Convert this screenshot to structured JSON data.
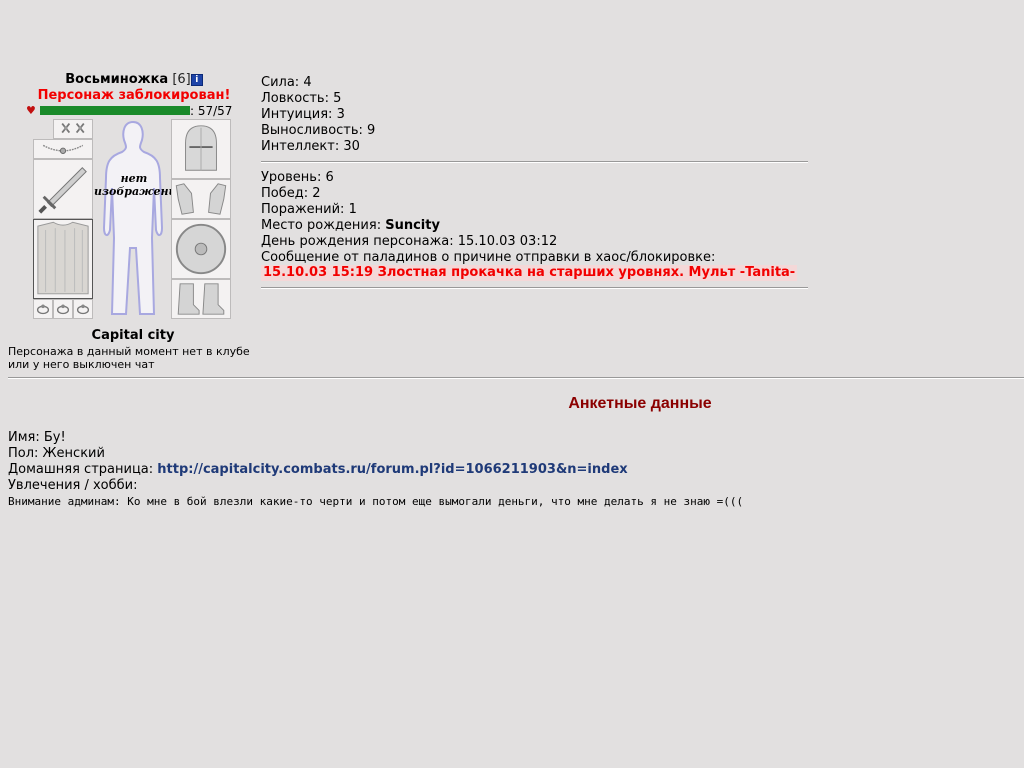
{
  "character": {
    "name": "Восьминожка",
    "level": "[6]",
    "blocked": "Персонаж заблокирован!",
    "hp": "57/57",
    "hp_fraction": 1.0,
    "no_image": "нет изображения",
    "city": "Capital city",
    "status": "Персонажа в данный момент нет в клубе или у него выключен чат"
  },
  "stats": {
    "strength": "Сила: 4",
    "agility": "Ловкость: 5",
    "intuition": "Интуиция: 3",
    "endurance": "Выносливость: 9",
    "intellect": "Интеллект: 30"
  },
  "info": {
    "level": "Уровень: 6",
    "wins": "Побед: 2",
    "losses": "Поражений: 1",
    "birthplace_label": "Место рождения: ",
    "birthplace_value": "Suncity",
    "birthday": "День рождения персонажа: 15.10.03 03:12",
    "paladin_msg_label": "Сообщение от паладинов о причине отправки в хаос/блокировке:",
    "paladin_msg": "15.10.03 15:19 Злостная прокачка на старших уровнях. Мульт -Tanita-"
  },
  "profile": {
    "section_title": "Анкетные данные",
    "name": "Имя: Бу!",
    "gender": "Пол: Женский",
    "homepage_label": "Домашняя страница: ",
    "homepage_url": "http://capitalcity.combats.ru/forum.pl?id=1066211903&n=index",
    "hobbies": "Увлечения / хобби:",
    "admin_note": "Внимание админам: Ко мне в бой влезли какие-то черти и потом еще вымогали деньги, что мне делать я не знаю =((("
  },
  "icons": [
    "info-icon",
    "heart-icon",
    "earrings-icon",
    "amulet-icon",
    "sword-icon",
    "armor-icon",
    "ring-icon",
    "helmet-icon",
    "gloves-icon",
    "shield-icon",
    "boots-icon",
    "silhouette-icon"
  ],
  "colors": {
    "background": "#e2e0e0",
    "blocked": "#f20000",
    "hp_bar": "#1a8a2a",
    "title": "#8b0000",
    "link": "#1f3a78"
  }
}
